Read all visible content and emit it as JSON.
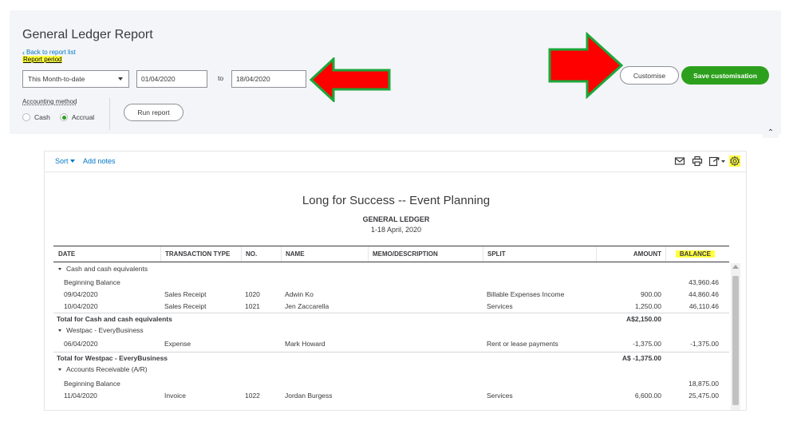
{
  "header": {
    "title": "General Ledger Report",
    "back_link": "Back to report list",
    "report_period_label": "Report period",
    "period_select": "This Month-to-date",
    "date_from": "01/04/2020",
    "to_label": "to",
    "date_to": "18/04/2020",
    "accounting_method_label": "Accounting method",
    "radio_cash": "Cash",
    "radio_accrual": "Accrual",
    "run_report": "Run report",
    "customise": "Customise",
    "save_customisation": "Save customisation"
  },
  "toolbar": {
    "sort": "Sort",
    "add_notes": "Add notes",
    "icons": [
      "email-icon",
      "print-icon",
      "export-icon",
      "settings-gear-icon"
    ]
  },
  "report": {
    "company": "Long for Success -- Event Planning",
    "title": "GENERAL LEDGER",
    "dates": "1-18 April, 2020",
    "columns": {
      "date": "DATE",
      "type": "TRANSACTION TYPE",
      "no": "NO.",
      "name": "NAME",
      "memo": "MEMO/DESCRIPTION",
      "split": "SPLIT",
      "amount": "AMOUNT",
      "balance": "BALANCE"
    },
    "rows": [
      {
        "kind": "group",
        "label": "Cash and cash equivalents"
      },
      {
        "kind": "data",
        "date": "Beginning Balance",
        "type": "",
        "no": "",
        "name": "",
        "memo": "",
        "split": "",
        "amount": "",
        "balance": "43,960.46"
      },
      {
        "kind": "data",
        "date": "09/04/2020",
        "type": "Sales Receipt",
        "no": "1020",
        "name": "Adwin Ko",
        "memo": "",
        "split": "Billable Expenses Income",
        "amount": "900.00",
        "balance": "44,860.46"
      },
      {
        "kind": "data",
        "date": "10/04/2020",
        "type": "Sales Receipt",
        "no": "1021",
        "name": "Jen Zaccarella",
        "memo": "",
        "split": "Services",
        "amount": "1,250.00",
        "balance": "46,110.46"
      },
      {
        "kind": "total",
        "label": "Total for Cash and cash equivalents",
        "amount": "A$2,150.00"
      },
      {
        "kind": "group",
        "label": "Westpac - EveryBusiness"
      },
      {
        "kind": "data",
        "date": "06/04/2020",
        "type": "Expense",
        "no": "",
        "name": "Mark Howard",
        "memo": "",
        "split": "Rent or lease payments",
        "amount": "-1,375.00",
        "balance": "-1,375.00"
      },
      {
        "kind": "total",
        "label": "Total for Westpac - EveryBusiness",
        "amount": "A$ -1,375.00"
      },
      {
        "kind": "group",
        "label": "Accounts Receivable (A/R)"
      },
      {
        "kind": "data",
        "date": "Beginning Balance",
        "type": "",
        "no": "",
        "name": "",
        "memo": "",
        "split": "",
        "amount": "",
        "balance": "18,875.00"
      },
      {
        "kind": "data",
        "date": "11/04/2020",
        "type": "Invoice",
        "no": "1022",
        "name": "Jordan Burgess",
        "memo": "",
        "split": "Services",
        "amount": "6,600.00",
        "balance": "25,475.00"
      }
    ]
  },
  "colors": {
    "accent_green": "#2ca01c",
    "link_blue": "#0077c5",
    "highlight_yellow": "#ffff40",
    "annotation_arrow_red": "#ff0000",
    "annotation_arrow_border": "#1aa83a"
  }
}
